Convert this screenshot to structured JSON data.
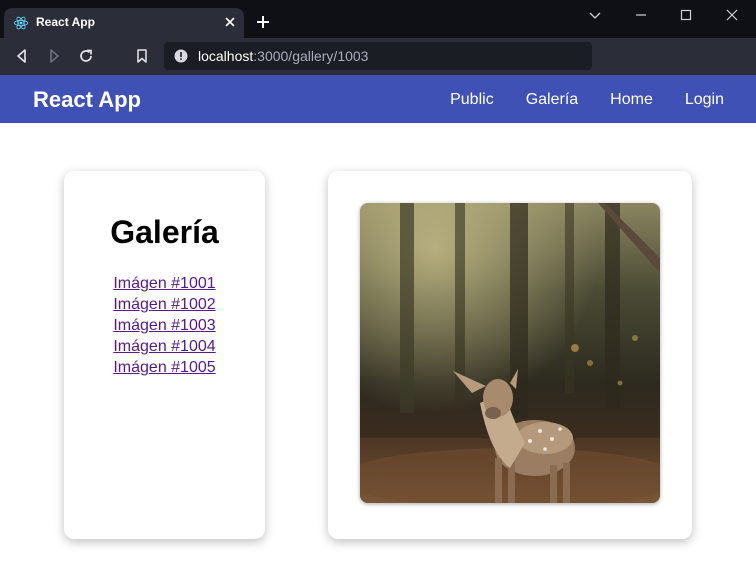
{
  "browser": {
    "tab_title": "React App",
    "url_host": "localhost",
    "url_path": ":3000/gallery/1003"
  },
  "navbar": {
    "brand": "React App",
    "links": [
      "Public",
      "Galería",
      "Home",
      "Login"
    ]
  },
  "sidebar": {
    "title": "Galería",
    "items": [
      "Imágen #1001",
      "Imágen #1002",
      "Imágen #1003",
      "Imágen #1004",
      "Imágen #1005"
    ]
  },
  "main": {
    "image": {
      "subject": "deer-photo"
    }
  },
  "colors": {
    "navbar_bg": "#3f51b5",
    "link_visited": "#551a8b",
    "chrome_dark": "#0e1016",
    "chrome_toolbar": "#2b2d38"
  }
}
